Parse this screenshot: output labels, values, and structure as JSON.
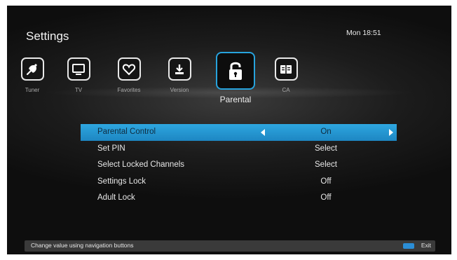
{
  "header": {
    "title": "Settings",
    "clock": "Mon 18:51"
  },
  "categories": [
    {
      "label": "Tuner",
      "icon": "satellite-dish-icon",
      "active": false
    },
    {
      "label": "TV",
      "icon": "tv-icon",
      "active": false
    },
    {
      "label": "Favorites",
      "icon": "heart-icon",
      "active": false
    },
    {
      "label": "Version",
      "icon": "download-icon",
      "active": false
    },
    {
      "label": "Parental",
      "icon": "lock-icon",
      "active": true
    },
    {
      "label": "CA",
      "icon": "card-icon",
      "active": false
    }
  ],
  "menu": [
    {
      "label": "Parental Control",
      "value": "On",
      "selected": true
    },
    {
      "label": "Set PIN",
      "value": "Select"
    },
    {
      "label": "Select Locked Channels",
      "value": "Select"
    },
    {
      "label": "Settings Lock",
      "value": "Off"
    },
    {
      "label": "Adult Lock",
      "value": "Off"
    }
  ],
  "footer": {
    "hint": "Change value using navigation buttons",
    "exit_label": "Exit"
  },
  "colors": {
    "accent": "#27a3dd",
    "selection": "#2ea7e0",
    "background": "#1c1c1c",
    "exit_key": "#2b8ed6"
  }
}
